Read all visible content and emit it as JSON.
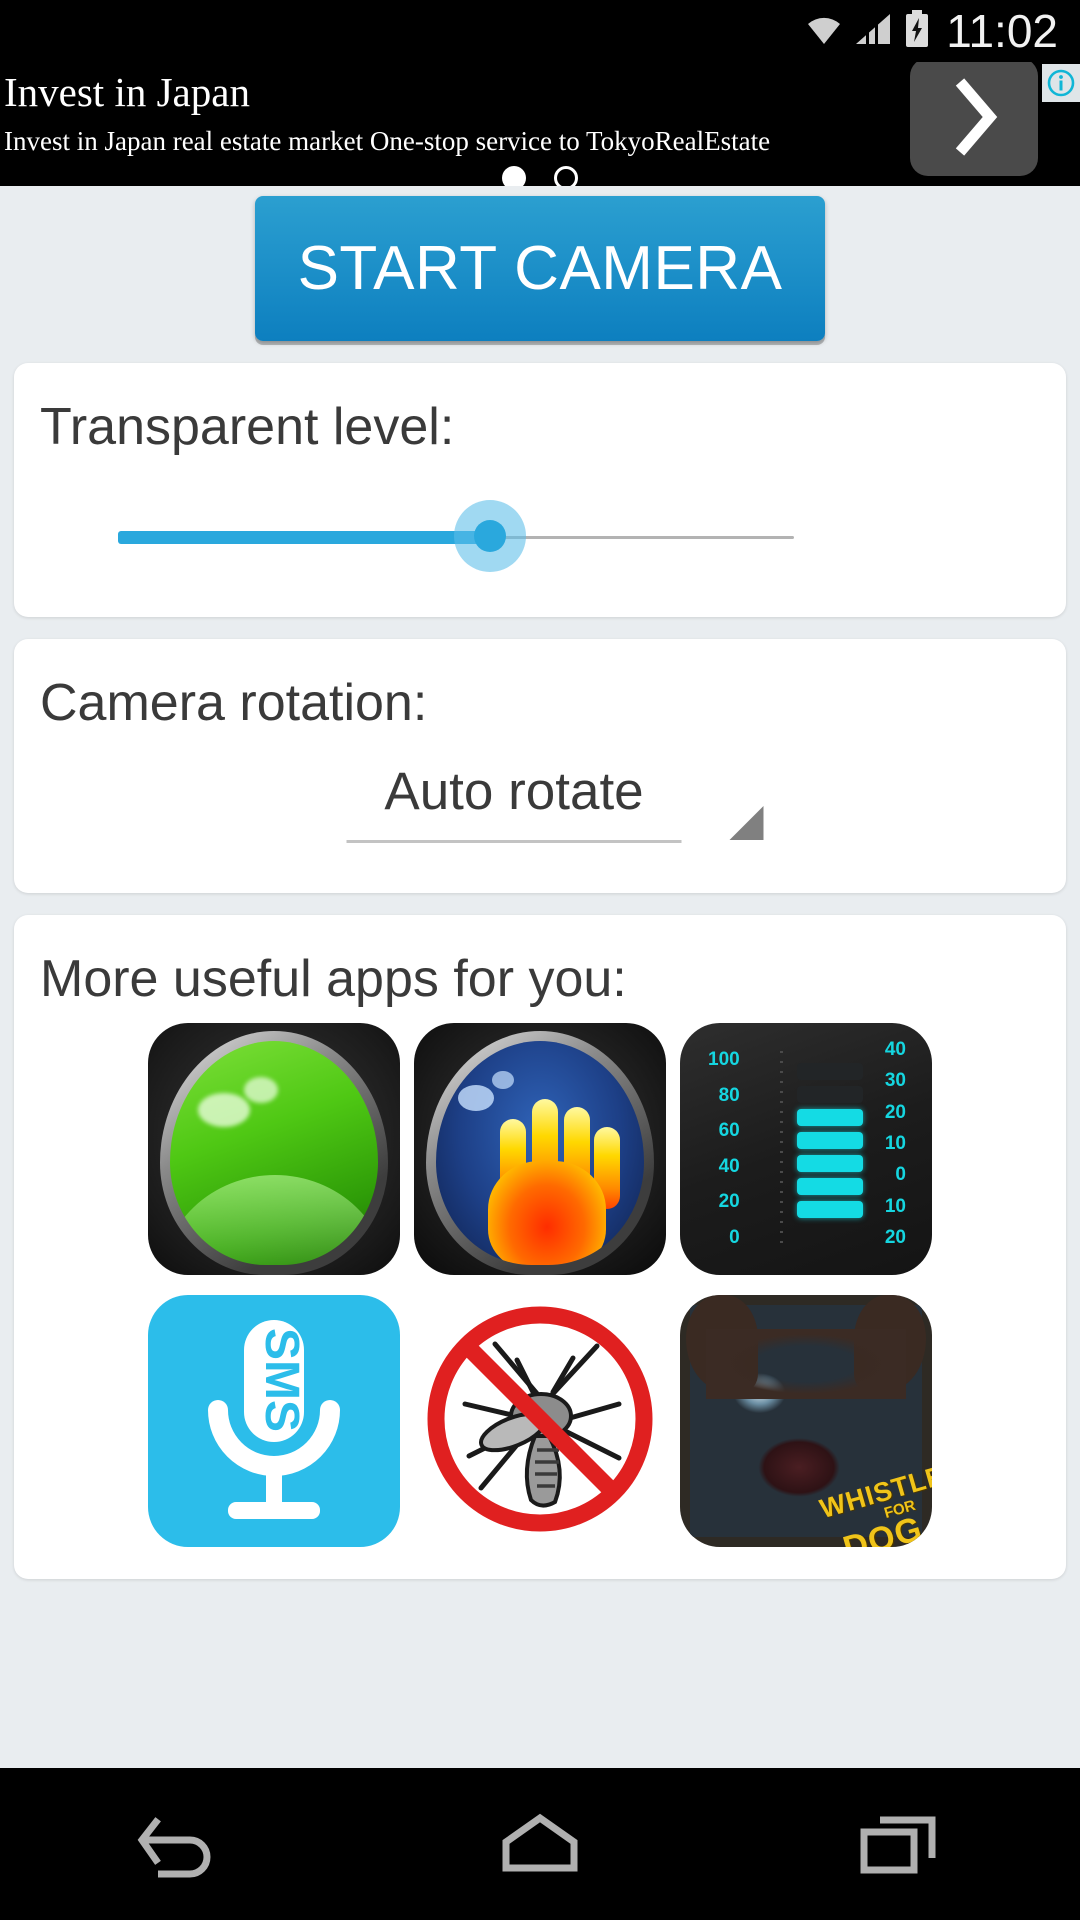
{
  "status_bar": {
    "time": "11:02",
    "icons": [
      "wifi-icon",
      "signal-icon",
      "battery-charging-icon"
    ]
  },
  "ad_banner": {
    "title": "Invest in Japan",
    "subtitle": "Invest in Japan real estate market One-stop service to TokyoRealEstate",
    "cta_icon": "chevron-right-icon",
    "info_icon": "ad-info-icon",
    "page_dots": 2,
    "active_dot": 0
  },
  "main": {
    "start_camera_label": "START CAMERA",
    "transparent": {
      "label": "Transparent level:",
      "value_percent": 55
    },
    "rotation": {
      "label": "Camera rotation:",
      "selected": "Auto rotate",
      "caret_icon": "dropdown-caret-icon"
    },
    "more_apps": {
      "label": "More useful apps for you:",
      "items": [
        {
          "name": "night-vision-camera",
          "icon": "night-vision-icon"
        },
        {
          "name": "thermal-camera",
          "icon": "thermal-camera-icon"
        },
        {
          "name": "thermometer",
          "icon": "thermometer-icon",
          "scale_left": [
            "100",
            "80",
            "60",
            "40",
            "20",
            "0"
          ],
          "scale_right": [
            "40",
            "30",
            "20",
            "10",
            "0",
            "10",
            "20"
          ],
          "bars_on": 5,
          "bars_off": 2
        },
        {
          "name": "sms-voice",
          "icon": "microphone-icon",
          "label": "SMS"
        },
        {
          "name": "anti-mosquito",
          "icon": "no-mosquito-icon"
        },
        {
          "name": "whistle-for-dog",
          "icon": "dog-icon",
          "line1": "WHISTLE",
          "line2": "FOR",
          "line3": "DOG"
        }
      ]
    }
  },
  "nav_bar": {
    "back_icon": "back-icon",
    "home_icon": "home-icon",
    "recents_icon": "recents-icon"
  },
  "colors": {
    "accent": "#2aa8dd",
    "button": "#1e91c9",
    "page_bg": "#e9edf0",
    "card": "#ffffff",
    "meter_cyan": "#15d6e0",
    "sms_blue": "#2cbdea",
    "whistle_yellow": "#f0c419"
  }
}
